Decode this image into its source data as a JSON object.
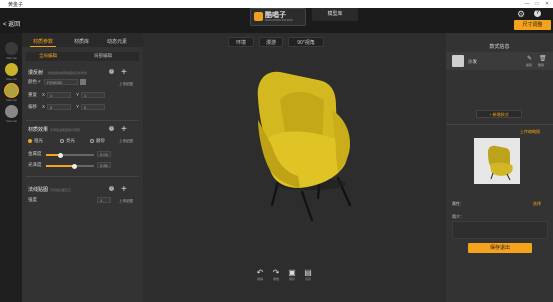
{
  "window": {
    "title": "黄金子",
    "controls": [
      "—",
      "□",
      "✕"
    ]
  },
  "header": {
    "back_label": "< 返回",
    "logo_text": "酷唱子",
    "logo_sub": "UNKNOWN STUDIO",
    "model_lib_tab": "模型库",
    "size_button": "尺寸调整",
    "help_label": "?"
  },
  "left_rail": {
    "swatches": [
      {
        "label": "Material",
        "color": "#3a3a3a"
      },
      {
        "label": "Material",
        "color": "#c8b32a"
      },
      {
        "label": "Material",
        "color": "#b0a040"
      },
      {
        "label": "Material",
        "color": "#888888"
      }
    ]
  },
  "left_panel": {
    "tabs": [
      "材质参数",
      "材质库",
      "动态元素"
    ],
    "subtabs": [
      "全局编辑",
      "局部编辑"
    ],
    "diffuse": {
      "title": "漫反射",
      "hint": "修改颜色或者贴图会同步修改",
      "color_label": "颜色",
      "color_prefix": "#",
      "color_value": "FE9E2B",
      "tile_label": "重复",
      "offset_label": "偏移",
      "x_label": "X",
      "y_label": "Y",
      "tile_x": "1",
      "tile_y": "1",
      "offset_x": "0",
      "offset_y": "0",
      "upload_label": "上传贴图"
    },
    "material_effect": {
      "title": "材质效果",
      "hint": "光泽度金属度等可调整",
      "options": [
        "哑光",
        "亮光",
        "磨砂"
      ],
      "selected": "哑光",
      "metal_label": "金属度",
      "metal_value": "0.04",
      "metal_fraction": 0.3,
      "gloss_label": "光泽度",
      "gloss_value": "0.86",
      "gloss_fraction": 0.6,
      "upload_label": "上传贴图"
    },
    "normal_map": {
      "title": "法线贴图",
      "hint": "可增强表面凹凸",
      "strength_label": "强度",
      "strength_value": "1",
      "upload_label": "上传贴图"
    }
  },
  "canvas": {
    "top_buttons": [
      "环境",
      "漫游",
      "90°视角"
    ],
    "bottom_buttons": [
      "撤销",
      "重做",
      "保存",
      "另存"
    ]
  },
  "right_panel": {
    "title": "款式信息",
    "item_name": "沙发",
    "edit_label": "编辑",
    "delete_label": "删除",
    "add_style": "+ 新增款式",
    "upload_link": "上传缩略图",
    "attr_label": "属性：",
    "attr_value": "选择",
    "intro_label": "简介：",
    "save_button": "保存退出"
  }
}
